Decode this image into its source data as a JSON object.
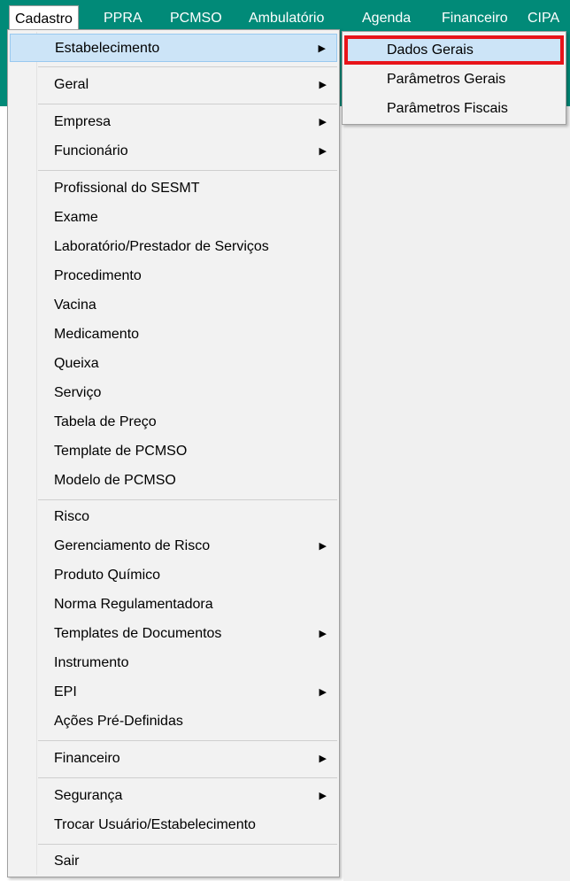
{
  "menubar": {
    "items": [
      "Cadastro",
      "PPRA",
      "PCMSO",
      "Ambulatório",
      "Agenda",
      "Financeiro",
      "CIPA"
    ]
  },
  "cadastro_menu": {
    "items": [
      {
        "label": "Estabelecimento",
        "submenu": true
      },
      {
        "label": "Geral",
        "submenu": true
      },
      {
        "label": "Empresa",
        "submenu": true
      },
      {
        "label": "Funcionário",
        "submenu": true
      },
      {
        "label": "Profissional do SESMT",
        "submenu": false
      },
      {
        "label": "Exame",
        "submenu": false
      },
      {
        "label": "Laboratório/Prestador de Serviços",
        "submenu": false
      },
      {
        "label": "Procedimento",
        "submenu": false
      },
      {
        "label": "Vacina",
        "submenu": false
      },
      {
        "label": "Medicamento",
        "submenu": false
      },
      {
        "label": "Queixa",
        "submenu": false
      },
      {
        "label": "Serviço",
        "submenu": false
      },
      {
        "label": "Tabela de Preço",
        "submenu": false
      },
      {
        "label": "Template de PCMSO",
        "submenu": false
      },
      {
        "label": "Modelo de PCMSO",
        "submenu": false
      },
      {
        "label": "Risco",
        "submenu": false
      },
      {
        "label": "Gerenciamento de Risco",
        "submenu": true
      },
      {
        "label": "Produto Químico",
        "submenu": false
      },
      {
        "label": "Norma Regulamentadora",
        "submenu": false
      },
      {
        "label": "Templates de Documentos",
        "submenu": true
      },
      {
        "label": "Instrumento",
        "submenu": false
      },
      {
        "label": "EPI",
        "submenu": true
      },
      {
        "label": "Ações Pré-Definidas",
        "submenu": false
      },
      {
        "label": "Financeiro",
        "submenu": true
      },
      {
        "label": "Segurança",
        "submenu": true
      },
      {
        "label": "Trocar Usuário/Estabelecimento",
        "submenu": false
      },
      {
        "label": "Sair",
        "submenu": false
      }
    ]
  },
  "estabelecimento_submenu": {
    "items": [
      "Dados Gerais",
      "Parâmetros Gerais",
      "Parâmetros Fiscais"
    ]
  },
  "icons": {
    "submenu_arrow": "▶"
  },
  "colors": {
    "menubar": "#018a78",
    "highlight_border": "#e8141a",
    "hover": "#cce4f7"
  }
}
